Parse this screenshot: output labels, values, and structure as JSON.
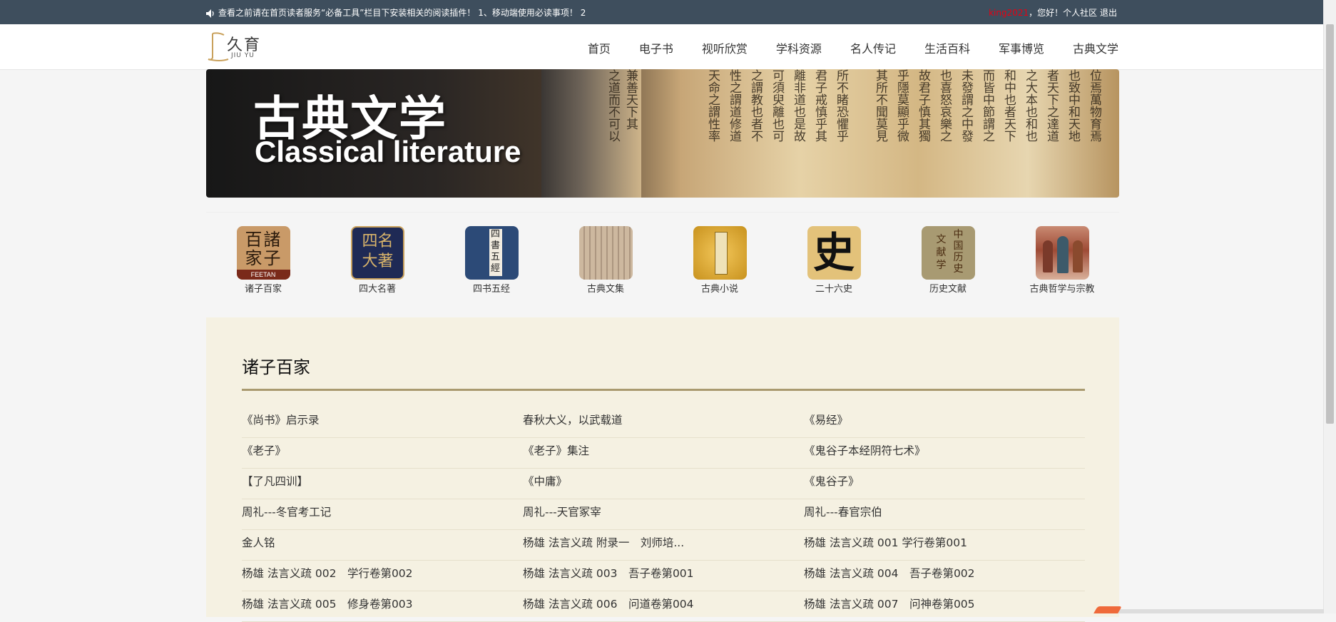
{
  "topbar": {
    "notice": "查看之前请在首页读者服务“必备工具”栏目下安装相关的阅读插件！  1、移动端使用必读事项！    2",
    "username": "king2021",
    "greeting": "，您好！",
    "community_link": "个人社区",
    "logout_link": "退出"
  },
  "logo": {
    "cn": "久育",
    "en": "JIU YU"
  },
  "menu": [
    "首页",
    "电子书",
    "视听欣赏",
    "学科资源",
    "名人传记",
    "生活百科",
    "军事博览",
    "古典文学"
  ],
  "banner": {
    "title_cn": "古典文学",
    "title_en": "Classical literature"
  },
  "categories": [
    {
      "label": "诸子百家",
      "icon": "zhuzibaijia-icon",
      "text": "百诸\n家子",
      "sub": "FEETAN",
      "color": "#c99a68"
    },
    {
      "label": "四大名著",
      "icon": "sidamingzhu-icon",
      "text": "四名\n大著",
      "color": "#1f2a55"
    },
    {
      "label": "四书五经",
      "icon": "sishuwujing-icon",
      "text": "四書五經",
      "color": "#2c4a77"
    },
    {
      "label": "古典文集",
      "icon": "gudianwenji-icon",
      "color": "#c3a68a"
    },
    {
      "label": "古典小说",
      "icon": "gudianxiaoshuo-icon",
      "color": "#d9a638"
    },
    {
      "label": "二十六史",
      "icon": "ershiliushi-icon",
      "text": "史",
      "color": "#e3c27a"
    },
    {
      "label": "历史文献",
      "icon": "lishiwenxian-icon",
      "text": "中国历史\n文献学",
      "color": "#a89a72"
    },
    {
      "label": "古典哲学与宗教",
      "icon": "zhexuezongjiao-icon",
      "color": "#b86b52"
    }
  ],
  "section": {
    "title": "诸子百家",
    "rows": [
      [
        "《尚书》启示录",
        "春秋大义，以武载道",
        "《易经》"
      ],
      [
        "《老子》",
        "《老子》集注",
        "《鬼谷子本经阴符七术》"
      ],
      [
        "【了凡四训】",
        "《中庸》",
        "《鬼谷子》"
      ],
      [
        "周礼---冬官考工记",
        "周礼---天官冢宰",
        "周礼---春官宗伯"
      ],
      [
        "金人铭",
        "杨雄 法言义疏 附录一　刘师培...",
        "杨雄 法言义疏 001 学行卷第001"
      ],
      [
        "杨雄 法言义疏 002　学行卷第002",
        "杨雄 法言义疏 003　吾子卷第001",
        "杨雄 法言义疏 004　吾子卷第002"
      ],
      [
        "杨雄 法言义疏 005　修身卷第003",
        "杨雄 法言义疏 006　问道卷第004",
        "杨雄 法言义疏 007　问神卷第005"
      ]
    ]
  }
}
